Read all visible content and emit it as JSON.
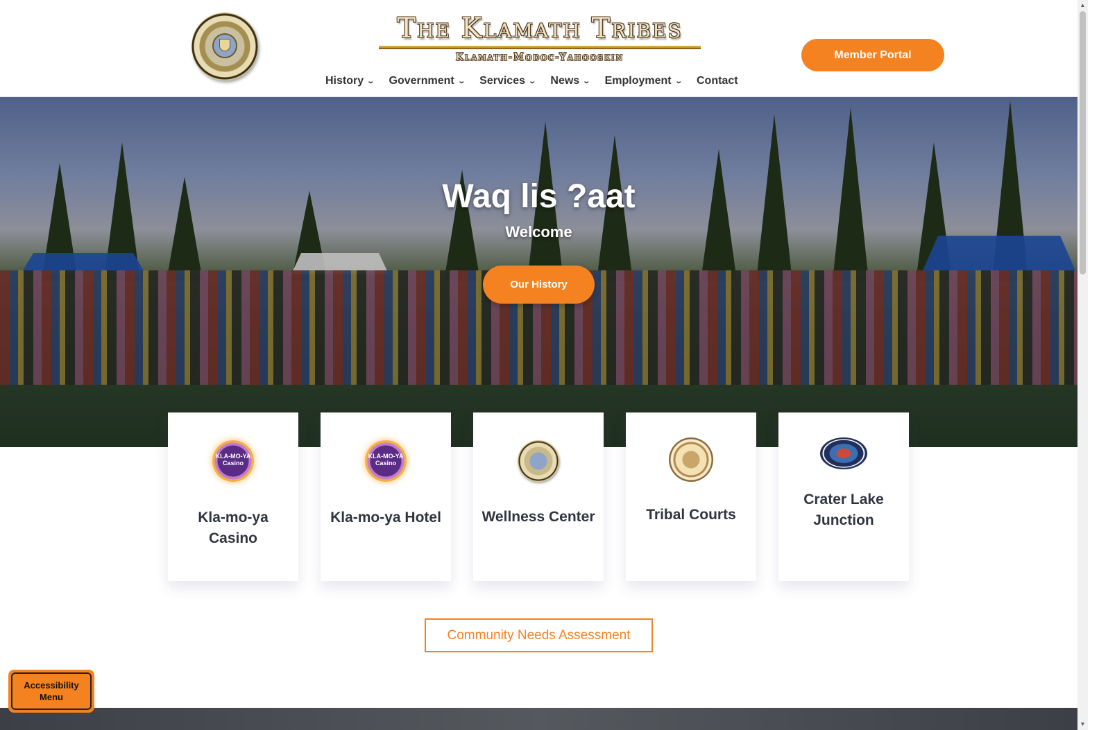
{
  "header": {
    "brand_title": "The Klamath Tribes",
    "brand_subtitle": "Klamath-Modoc-Yahooskin",
    "member_portal_label": "Member Portal"
  },
  "nav": {
    "items": [
      {
        "label": "History",
        "has_dropdown": true
      },
      {
        "label": "Government",
        "has_dropdown": true
      },
      {
        "label": "Services",
        "has_dropdown": true
      },
      {
        "label": "News",
        "has_dropdown": true
      },
      {
        "label": "Employment",
        "has_dropdown": true
      },
      {
        "label": "Contact",
        "has_dropdown": false
      }
    ],
    "dropdown_icon": "chevron-down-icon"
  },
  "hero": {
    "title": "Waq lis ?aat",
    "subtitle": "Welcome",
    "button_label": "Our History"
  },
  "cards": [
    {
      "title": "Kla-mo-ya Casino",
      "logo_text": "KLA-MO-YA Casino",
      "logo": "kla-mo-ya-casino-logo"
    },
    {
      "title": "Kla-mo-ya Hotel",
      "logo_text": "KLA-MO-YA Casino",
      "logo": "kla-mo-ya-casino-logo"
    },
    {
      "title": "Wellness Center",
      "logo": "klamath-tribes-seal"
    },
    {
      "title": "Tribal Courts",
      "logo": "klamath-tribal-courts-seal"
    },
    {
      "title": "Crater Lake Junction",
      "logo": "crater-lake-travel-center-logo"
    }
  ],
  "community_needs_label": "Community Needs Assessment",
  "accessibility_label": "Accessibility\nMenu",
  "colors": {
    "accent": "#f58220",
    "text_dark": "#2f3540",
    "background": "#ffffff"
  }
}
